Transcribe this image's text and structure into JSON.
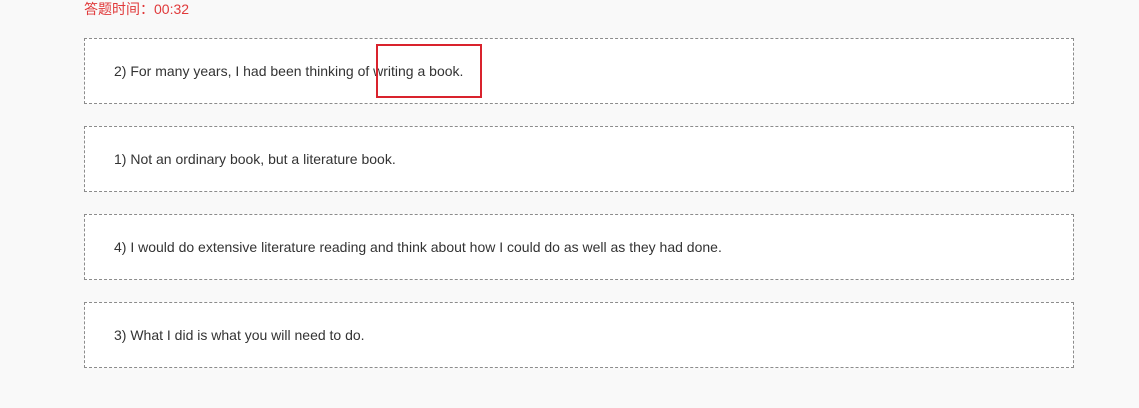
{
  "timer": {
    "label": "答题时间：",
    "value": "00:32"
  },
  "cards": [
    {
      "text": "2) For many years, I had been thinking of writing a book."
    },
    {
      "text": "1) Not an ordinary book, but a literature book."
    },
    {
      "text": "4) I would do extensive literature reading and think about how I could do as well as they had done."
    },
    {
      "text": "3) What I did is what you will need to do."
    }
  ],
  "colors": {
    "timer": "#e0393a",
    "highlight": "#d9232d",
    "border": "#8c8c8c"
  }
}
